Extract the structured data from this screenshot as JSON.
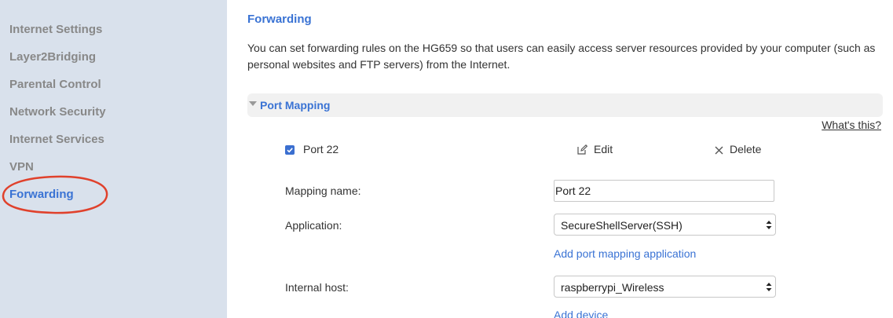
{
  "sidebar": {
    "items": [
      {
        "label": "Internet Settings"
      },
      {
        "label": "Layer2Bridging"
      },
      {
        "label": "Parental Control"
      },
      {
        "label": "Network Security"
      },
      {
        "label": "Internet Services"
      },
      {
        "label": "VPN"
      },
      {
        "label": "Forwarding",
        "active": true
      }
    ],
    "highlight_color": "#e0412c"
  },
  "main": {
    "title": "Forwarding",
    "description": "You can set forwarding rules on the HG659 so that users can easily access server resources provided by your computer (such as personal websites and FTP servers) from the Internet.",
    "section": {
      "title": "Port Mapping",
      "help_link": "What's this?"
    },
    "rule": {
      "checked": true,
      "name": "Port 22",
      "edit_label": "Edit",
      "delete_label": "Delete"
    },
    "form": {
      "mapping_name_label": "Mapping name:",
      "mapping_name_value": "Port 22",
      "application_label": "Application:",
      "application_value": "SecureShellServer(SSH)",
      "add_application_link": "Add port mapping application",
      "internal_host_label": "Internal host:",
      "internal_host_value": "raspberrypi_Wireless",
      "add_device_link": "Add device"
    }
  },
  "colors": {
    "accent": "#3a73d4",
    "sidebar_bg": "#d9e1ec",
    "inactive_nav": "#888888"
  }
}
